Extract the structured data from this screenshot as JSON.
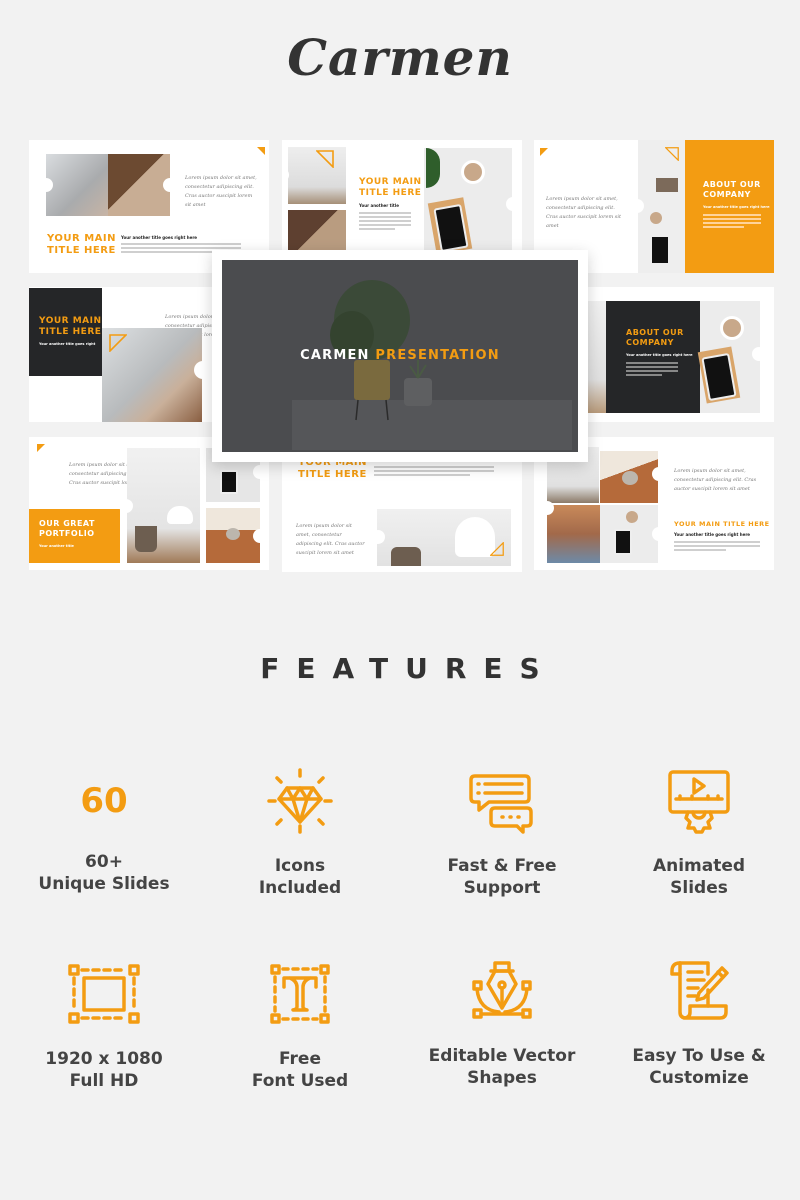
{
  "brand": {
    "logo": "Carmen",
    "accent": "#f39c12",
    "dark": "#252628",
    "background": "#f2f2f2"
  },
  "slides": {
    "s1": {
      "title_1": "YOUR MAIN",
      "title_2": "TITLE HERE",
      "subtitle": "Your another title goes right here",
      "handwriting": "Lorem ipsum dolor sit amet, consectetur adipiscing elit. Cras auctor suscipit lorem sit amet"
    },
    "s2": {
      "title_1": "YOUR MAIN",
      "title_2": "TITLE HERE",
      "subtitle": "Your another title"
    },
    "s3": {
      "title_1": "ABOUT OUR",
      "title_2": "COMPANY",
      "subtitle": "Your another title goes right here",
      "handwriting": "Lorem ipsum dolor sit amet, consectetur adipiscing elit. Cras auctor suscipit lorem sit amet"
    },
    "s4": {
      "title_1": "YOUR MAIN",
      "title_2": "TITLE HERE",
      "subtitle": "Your another title goes right",
      "handwriting": "Lorem ipsum dolor sit amet, consectetur adipiscing elit. Cras auctor suscipit lorem sit amet"
    },
    "s6": {
      "title_1": "ABOUT OUR",
      "title_2": "COMPANY",
      "subtitle": "Your another title goes right here"
    },
    "s7": {
      "title_1": "OUR GREAT",
      "title_2": "PORTFOLIO",
      "subtitle": "Your another title",
      "handwriting": "Lorem ipsum dolor sit amet, consectetur adipiscing elit. Cras auctor suscipit lorem sit"
    },
    "s8": {
      "title_1": "YOUR MAIN",
      "title_2": "TITLE HERE",
      "handwriting": "Lorem ipsum dolor sit amet, consectetur adipiscing elit. Cras auctor suscipit lorem sit amet"
    },
    "s9": {
      "title": "YOUR MAIN TITLE HERE",
      "subtitle": "Your another title goes right here",
      "handwriting": "Lorem ipsum dolor sit amet, consectetur adipiscing elit. Cras auctor suscipit lorem sit amet"
    }
  },
  "hero": {
    "title_white": "CARMEN",
    "title_accent": "PRESENTATION"
  },
  "features": {
    "heading": "FEATURES",
    "items": [
      {
        "icon": "number-60",
        "big": "60",
        "line1": "60+",
        "line2": "Unique Slides"
      },
      {
        "icon": "diamond-icon",
        "line1": "Icons",
        "line2": "Included"
      },
      {
        "icon": "chat-bubbles-icon",
        "line1": "Fast & Free",
        "line2": "Support"
      },
      {
        "icon": "animated-monitor-gear-icon",
        "line1": "Animated",
        "line2": "Slides"
      },
      {
        "icon": "resize-frame-icon",
        "line1": "1920 x 1080",
        "line2": "Full HD"
      },
      {
        "icon": "font-t-icon",
        "line1": "Free",
        "line2": "Font Used"
      },
      {
        "icon": "pen-tool-icon",
        "line1": "Editable Vector",
        "line2": "Shapes"
      },
      {
        "icon": "document-edit-icon",
        "line1": "Easy To Use &",
        "line2": "Customize"
      }
    ]
  }
}
